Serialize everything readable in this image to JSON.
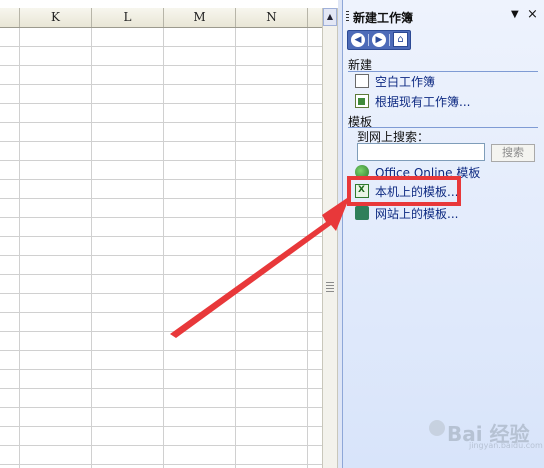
{
  "sheet": {
    "columns": [
      "K",
      "L",
      "M",
      "N"
    ]
  },
  "task_pane": {
    "title": "新建工作簿",
    "menu_glyph": "▼",
    "close_glyph": "×",
    "nav": {
      "back": "◀",
      "forward": "▶",
      "home": "⌂"
    },
    "new_section": {
      "heading": "新建",
      "items": [
        {
          "label": "空白工作簿",
          "icon": "blank-workbook-icon"
        },
        {
          "label": "根据现有工作簿...",
          "icon": "existing-workbook-icon"
        }
      ]
    },
    "templates_section": {
      "heading": "模板",
      "search_label": "到网上搜索：",
      "search_value": "",
      "search_button": "搜索",
      "items": [
        {
          "label": "Office Online 模板",
          "icon": "online-globe-icon"
        },
        {
          "label": "本机上的模板...",
          "icon": "local-template-icon"
        },
        {
          "label": "网站上的模板...",
          "icon": "website-template-icon"
        }
      ]
    }
  },
  "annotation": {
    "highlight_color": "#e8383a",
    "arrow_color": "#e8383a"
  },
  "watermark": {
    "text": "Bai 经验",
    "sub": "jingyan.baidu.com"
  },
  "colors": {
    "link": "#0e2a82",
    "pane_top": "#eef3fd",
    "pane_bottom": "#d8e4fa"
  }
}
